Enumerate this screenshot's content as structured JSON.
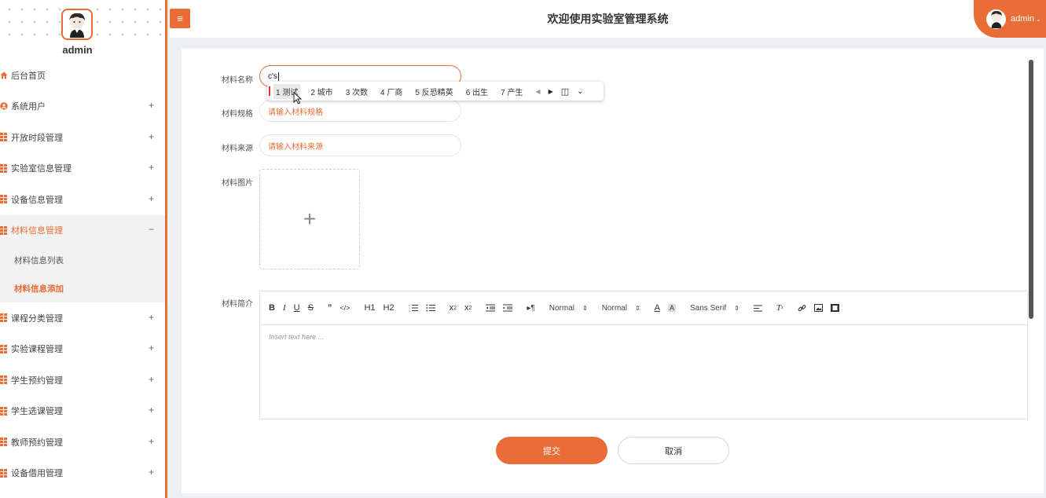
{
  "sidebar": {
    "username": "admin",
    "items": [
      {
        "label": "后台首页",
        "icon": "home-icon",
        "toggle": ""
      },
      {
        "label": "系统用户",
        "icon": "user-icon",
        "toggle": "+"
      },
      {
        "label": "开放时段管理",
        "icon": "grid-icon",
        "toggle": "+"
      },
      {
        "label": "实验室信息管理",
        "icon": "grid-icon",
        "toggle": "+"
      },
      {
        "label": "设备信息管理",
        "icon": "grid-icon",
        "toggle": "+"
      },
      {
        "label": "材料信息管理",
        "icon": "grid-icon",
        "toggle": "−"
      },
      {
        "label": "课程分类管理",
        "icon": "grid-icon",
        "toggle": "+"
      },
      {
        "label": "实验课程管理",
        "icon": "grid-icon",
        "toggle": "+"
      },
      {
        "label": "学生预约管理",
        "icon": "grid-icon",
        "toggle": "+"
      },
      {
        "label": "学生选课管理",
        "icon": "grid-icon",
        "toggle": "+"
      },
      {
        "label": "教师预约管理",
        "icon": "grid-icon",
        "toggle": "+"
      },
      {
        "label": "设备借用管理",
        "icon": "grid-icon",
        "toggle": "+"
      }
    ],
    "subitems": [
      {
        "label": "材料信息列表"
      },
      {
        "label": "材料信息添加"
      }
    ]
  },
  "header": {
    "menu_icon": "≡",
    "title": "欢迎使用实验室管理系统",
    "user": "admin"
  },
  "form": {
    "name_label": "材料名称",
    "name_value": "c's",
    "spec_label": "材料规格",
    "spec_placeholder": "请输入材料规格",
    "source_label": "材料来源",
    "source_placeholder": "请输入材料来源",
    "image_label": "材料图片",
    "upload_icon": "+",
    "intro_label": "材料简介",
    "editor_placeholder": "Insert text here ...",
    "submit": "提交",
    "cancel": "取消"
  },
  "toolbar": {
    "header1": "H1",
    "header2": "H2",
    "size_select": "Normal",
    "header_select": "Normal",
    "font_select": "Sans Serif"
  },
  "ime": {
    "candidates": [
      "1 测试",
      "2 城市",
      "3 次数",
      "4 厂商",
      "5 反恐精英",
      "6 出生",
      "7 产生"
    ]
  },
  "colors": {
    "accent": "#e96d36"
  }
}
